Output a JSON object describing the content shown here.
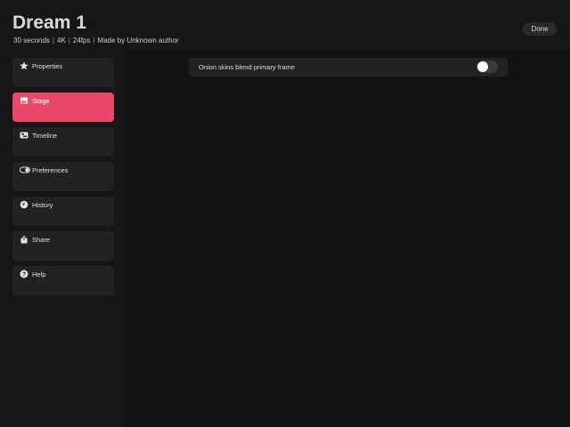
{
  "header": {
    "title": "Dream 1",
    "meta": {
      "duration": "30 seconds",
      "resolution": "4K",
      "fps": "24fps",
      "author": "Made by Unknown author",
      "separator": "|"
    },
    "done_label": "Done"
  },
  "sidebar": {
    "items": [
      {
        "label": "Properties",
        "icon": "star-icon",
        "active": false
      },
      {
        "label": "Stage",
        "icon": "image-icon",
        "active": true
      },
      {
        "label": "Timeline",
        "icon": "timeline-icon",
        "active": false
      },
      {
        "label": "Preferences",
        "icon": "toggle-icon",
        "active": false
      },
      {
        "label": "History",
        "icon": "history-icon",
        "active": false
      },
      {
        "label": "Share",
        "icon": "share-icon",
        "active": false
      },
      {
        "label": "Help",
        "icon": "help-icon",
        "active": false
      }
    ]
  },
  "settings": {
    "onion_skins": {
      "label": "Onion skins blend primary frame",
      "enabled": false
    }
  },
  "colors": {
    "background": "#161616",
    "panel": "#222222",
    "accent": "#e9486a",
    "text": "#e2e2e2"
  }
}
